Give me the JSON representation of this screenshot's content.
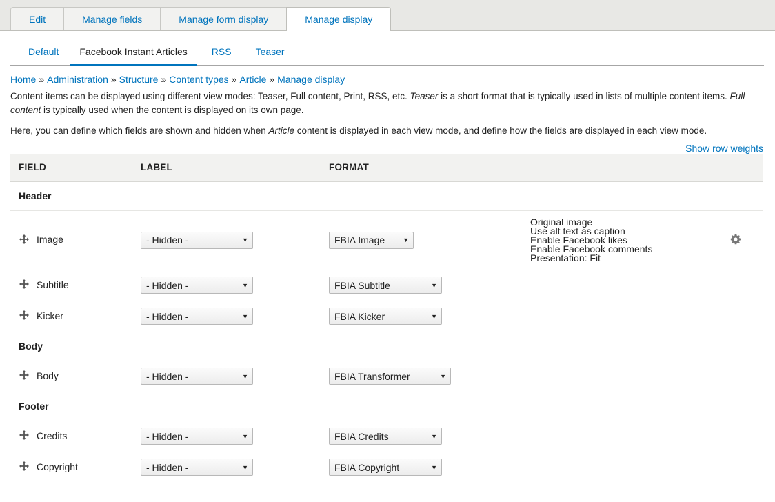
{
  "primary_tabs": [
    {
      "label": "Edit"
    },
    {
      "label": "Manage fields"
    },
    {
      "label": "Manage form display"
    },
    {
      "label": "Manage display"
    }
  ],
  "secondary_tabs": [
    {
      "label": "Default"
    },
    {
      "label": "Facebook Instant Articles"
    },
    {
      "label": "RSS"
    },
    {
      "label": "Teaser"
    }
  ],
  "breadcrumb": [
    "Home",
    "Administration",
    "Structure",
    "Content types",
    "Article",
    "Manage display"
  ],
  "breadcrumb_separator": "»",
  "help": {
    "p1_a": "Content items can be displayed using different view modes: Teaser, Full content, Print, RSS, etc. ",
    "p1_em1": "Teaser",
    "p1_b": " is a short format that is typically used in lists of multiple content items. ",
    "p1_em2": "Full content",
    "p1_c": " is typically used when the content is displayed on its own page.",
    "p2_a": "Here, you can define which fields are shown and hidden when ",
    "p2_em": "Article",
    "p2_b": " content is displayed in each view mode, and define how the fields are displayed in each view mode."
  },
  "show_row_weights": "Show row weights",
  "table": {
    "headers": {
      "field": "FIELD",
      "label": "LABEL",
      "format": "FORMAT"
    },
    "regions": {
      "header": "Header",
      "body": "Body",
      "footer": "Footer"
    },
    "rows": {
      "image": {
        "field": "Image",
        "label": "- Hidden -",
        "format": "FBIA Image",
        "summary": [
          "Original image",
          "Use alt text as caption",
          "Enable Facebook likes",
          "Enable Facebook comments",
          "Presentation: Fit"
        ]
      },
      "subtitle": {
        "field": "Subtitle",
        "label": "- Hidden -",
        "format": "FBIA Subtitle"
      },
      "kicker": {
        "field": "Kicker",
        "label": "- Hidden -",
        "format": "FBIA Kicker"
      },
      "body": {
        "field": "Body",
        "label": "- Hidden -",
        "format": "FBIA Transformer"
      },
      "credits": {
        "field": "Credits",
        "label": "- Hidden -",
        "format": "FBIA Credits"
      },
      "copyright": {
        "field": "Copyright",
        "label": "- Hidden -",
        "format": "FBIA Copyright"
      }
    }
  },
  "icons": {
    "drag": "drag-handle-icon",
    "settings": "gear-icon",
    "dropdown": "dropdown-arrow-icon"
  },
  "colors": {
    "link": "#0074bd",
    "tab_bar": "#e8e8e5",
    "header_bg": "#f2f2f0"
  }
}
